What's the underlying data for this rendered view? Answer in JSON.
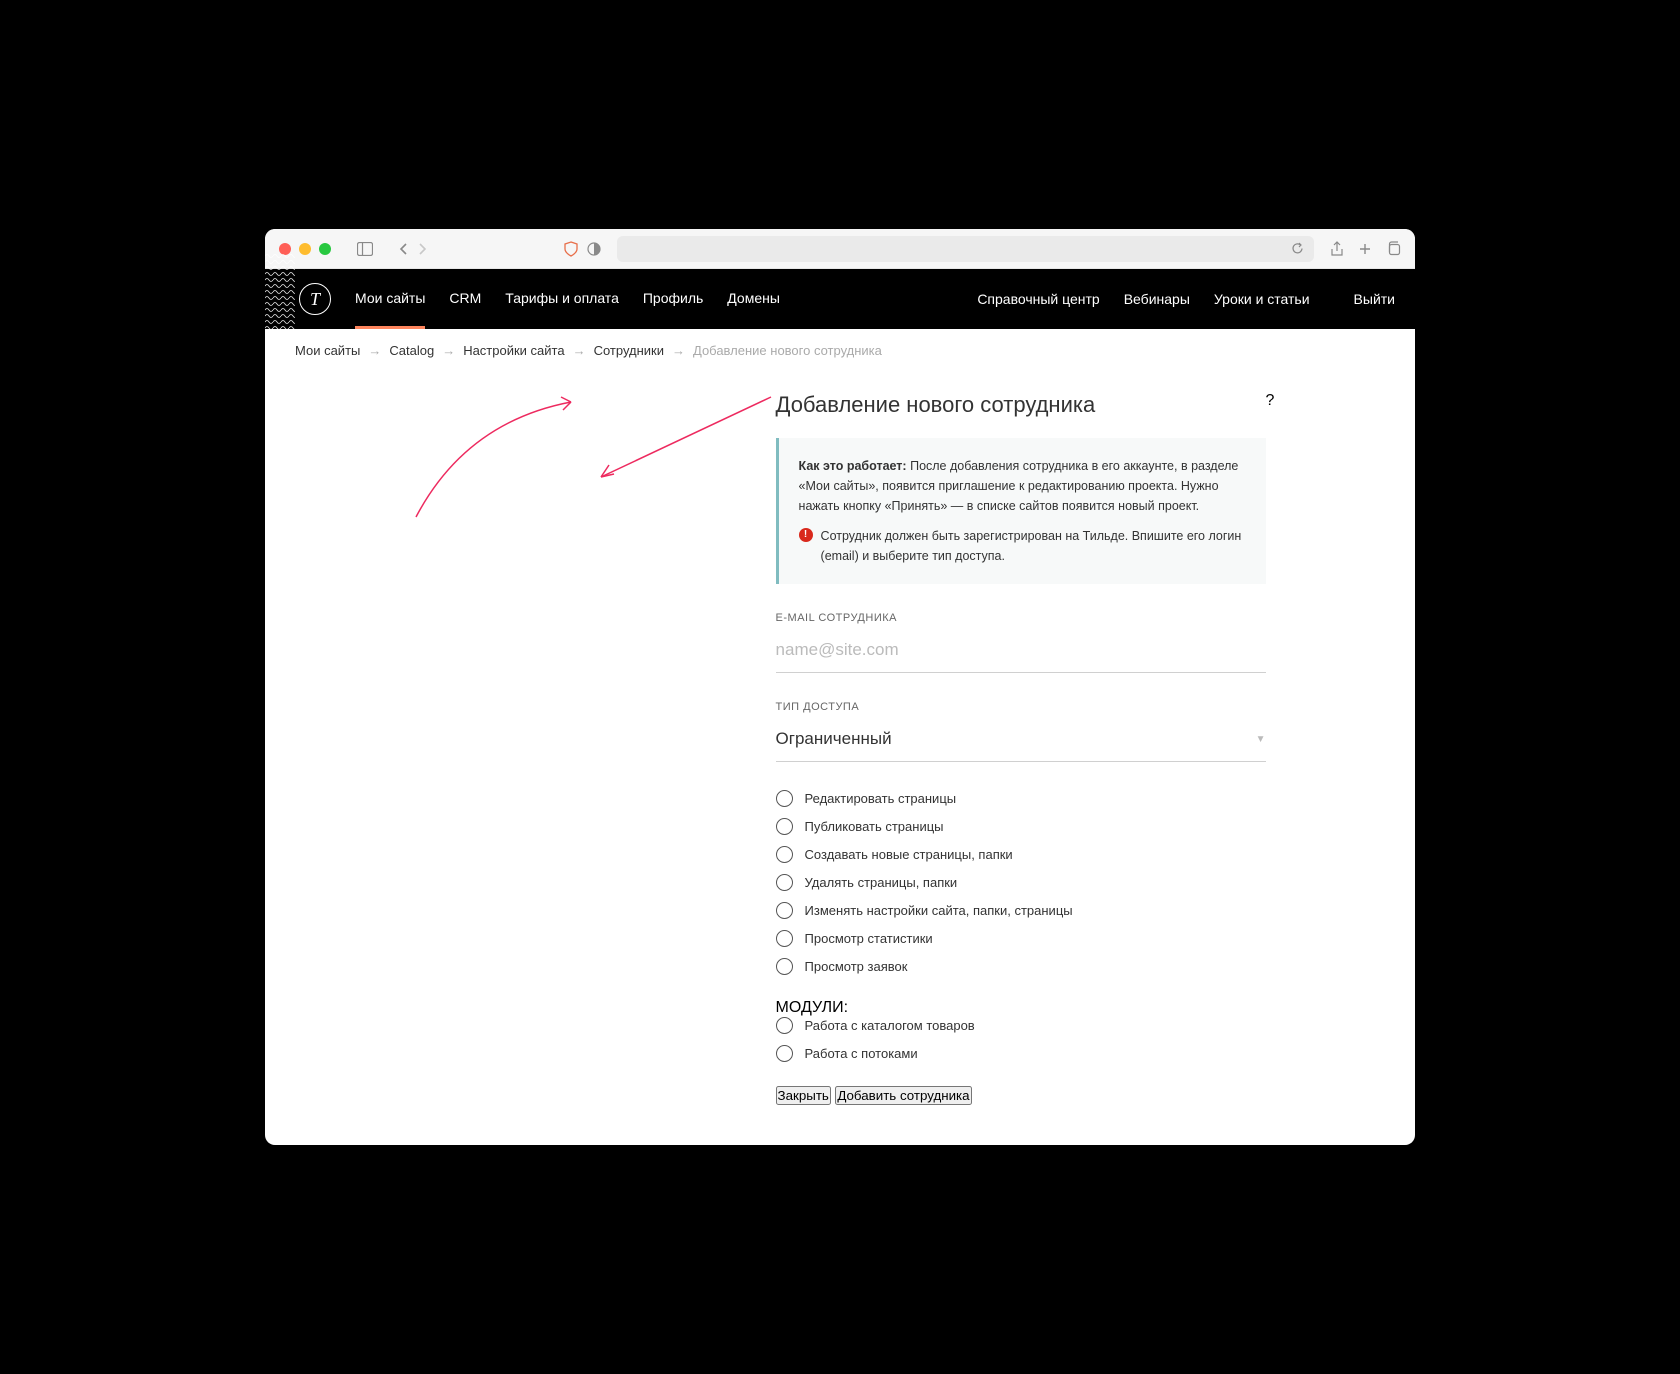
{
  "topnav": {
    "items": [
      "Мои сайты",
      "CRM",
      "Тарифы и оплата",
      "Профиль",
      "Домены"
    ],
    "right": [
      "Справочный центр",
      "Вебинары",
      "Уроки и статьи"
    ],
    "logout": "Выйти"
  },
  "breadcrumb": {
    "items": [
      "Мои сайты",
      "Catalog",
      "Настройки сайта",
      "Сотрудники"
    ],
    "current": "Добавление нового сотрудника"
  },
  "page_title": "Добавление нового сотрудника",
  "info": {
    "label": "Как это работает:",
    "text": "После добавления сотрудника в его аккаунте, в разделе «Мои сайты», появится приглашение к редактированию проекта. Нужно нажать кнопку «Принять» — в списке сайтов появится новый проект.",
    "warn": "Сотрудник должен быть зарегистрирован на Тильде. Впишите его логин (email) и выберите тип доступа."
  },
  "form": {
    "email_label": "E-MAIL СОТРУДНИКА",
    "email_placeholder": "name@site.com",
    "access_label": "ТИП ДОСТУПА",
    "access_value": "Ограниченный"
  },
  "permissions": [
    "Редактировать страницы",
    "Публиковать страницы",
    "Создавать новые страницы, папки",
    "Удалять страницы, папки",
    "Изменять настройки сайта, папки, страницы",
    "Просмотр статистики",
    "Просмотр заявок"
  ],
  "modules_label": "МОДУЛИ:",
  "modules": [
    "Работа с каталогом товаров",
    "Работа с потоками"
  ],
  "buttons": {
    "close": "Закрыть",
    "submit": "Добавить сотрудника"
  },
  "help": "?"
}
